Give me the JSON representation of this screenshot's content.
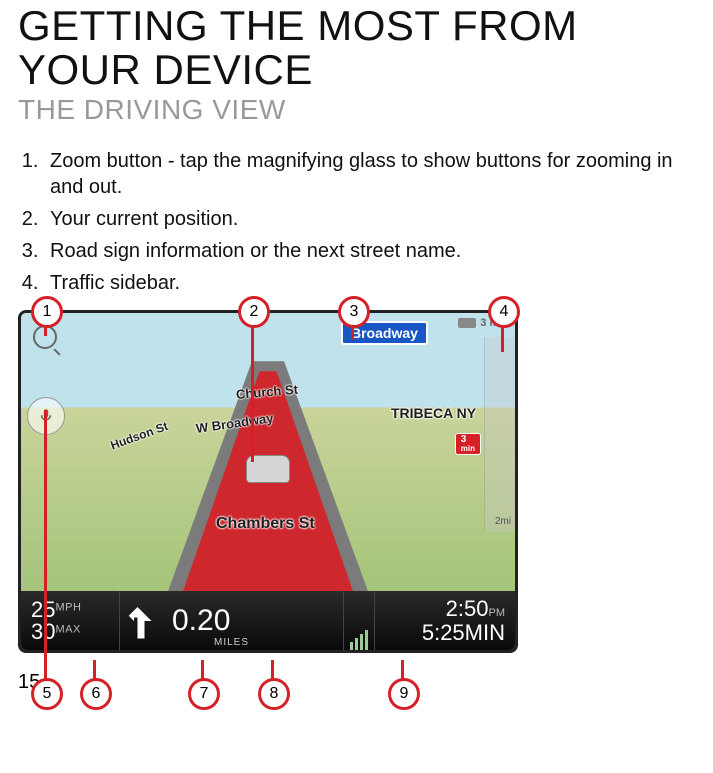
{
  "title": "GETTING THE MOST FROM YOUR DEVICE",
  "subtitle": "THE DRIVING VIEW",
  "list_items": [
    "Zoom button - tap the magnifying glass to show buttons for zooming in and out.",
    "Your current position.",
    "Road sign information or the next street name.",
    "Traffic sidebar."
  ],
  "map": {
    "sign": "Broadway",
    "streets": {
      "church": "Church St",
      "wbroadway": "W Broadway",
      "hudson": "Hudson St",
      "tribeca": "TRIBECA NY",
      "chambers": "Chambers St"
    },
    "traffic_top": "3 min",
    "traffic_scale": "2mi",
    "incident_value": "3",
    "incident_unit": "min"
  },
  "statusbar": {
    "speed_value": "25",
    "speed_unit": "MPH",
    "limit_value": "30",
    "limit_unit": "MAX",
    "distance": "0.20",
    "distance_unit": "MILES",
    "clock": "2:50",
    "clock_unit": "PM",
    "eta": "5:25",
    "eta_unit": "MIN"
  },
  "callouts": {
    "top": [
      "1",
      "2",
      "3",
      "4"
    ],
    "bottom": [
      "5",
      "6",
      "7",
      "8",
      "9"
    ]
  },
  "page_number": "15"
}
